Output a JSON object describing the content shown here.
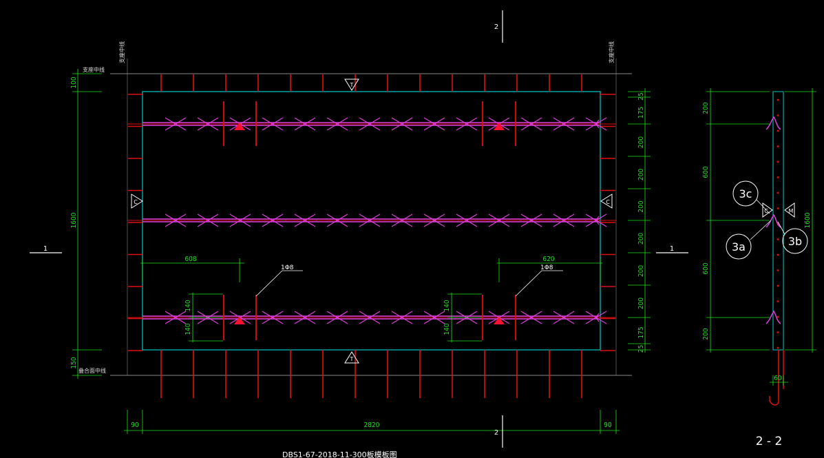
{
  "colors": {
    "background": "#000000",
    "panel_outline": "#00cccc",
    "rebar": "#e01010",
    "truss": "#e040e0",
    "dimension": "#19e619",
    "lifting_point": "#ff1030",
    "text": "#ffffff"
  },
  "plan": {
    "caption": "DBS1-67-2018-11-300板模板图",
    "section_mark_left": "1",
    "section_mark_right": "1",
    "section_mark_top": "2",
    "section_mark_bottom": "2",
    "support_label_left_vertical": "支座中线",
    "support_label_right_vertical": "支座中线",
    "support_label_top": "支座中线",
    "support_label_bottom": "叠合面中线",
    "view_marker_top": "T",
    "view_marker_bottom": "T",
    "view_marker_left": "C",
    "view_marker_right": "C",
    "dim_left_top": "100",
    "dim_left_total": "1600",
    "dim_left_bottom": "150",
    "dim_right": [
      "25",
      "175",
      "200",
      "200",
      "200",
      "200",
      "200",
      "200",
      "175",
      "25"
    ],
    "dim_bottom": [
      "90",
      "2820",
      "90"
    ],
    "dim_608": "608",
    "dim_620": "620",
    "dim_140_left": [
      "140",
      "140"
    ],
    "dim_140_right": [
      "140",
      "140"
    ],
    "bar_label_left": "1Φ8",
    "bar_label_right": "1Φ8"
  },
  "section": {
    "title": "2 - 2",
    "dim_left": [
      "200",
      "600",
      "600",
      "200"
    ],
    "dim_right": "1600",
    "dim_bottom": "60",
    "callout_3c": "3c",
    "callout_3a": "3a",
    "callout_3b": "3b",
    "marker_left": "C",
    "marker_right": "M"
  }
}
